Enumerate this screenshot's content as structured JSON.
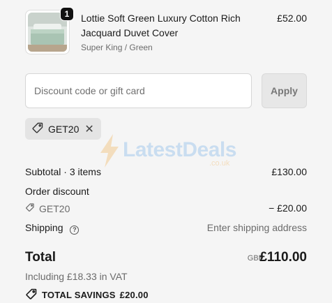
{
  "product": {
    "quantity": "1",
    "name": "Lottie Soft Green Luxury Cotton Rich Jacquard Duvet Cover",
    "variant": "Super King / Green",
    "price": "£52.00"
  },
  "discount": {
    "placeholder": "Discount code or gift card",
    "apply_label": "Apply",
    "applied_code": "GET20"
  },
  "watermark": {
    "text": "LatestDeals",
    "sub": ".co.uk"
  },
  "summary": {
    "subtotal_label": "Subtotal · 3 items",
    "subtotal_value": "£130.00",
    "order_discount_label": "Order discount",
    "discount_code": "GET20",
    "discount_value": "− £20.00",
    "shipping_label": "Shipping",
    "shipping_value": "Enter shipping address",
    "total_label": "Total",
    "currency": "GBP",
    "total_value": "£110.00",
    "vat_text": "Including £18.33 in VAT",
    "savings_label": "TOTAL SAVINGS",
    "savings_value": "£20.00"
  },
  "colors": {
    "background": "#f5f5f5",
    "text": "#1a1a1a",
    "muted": "#6b6b6b",
    "chip": "#e4e4e4"
  }
}
